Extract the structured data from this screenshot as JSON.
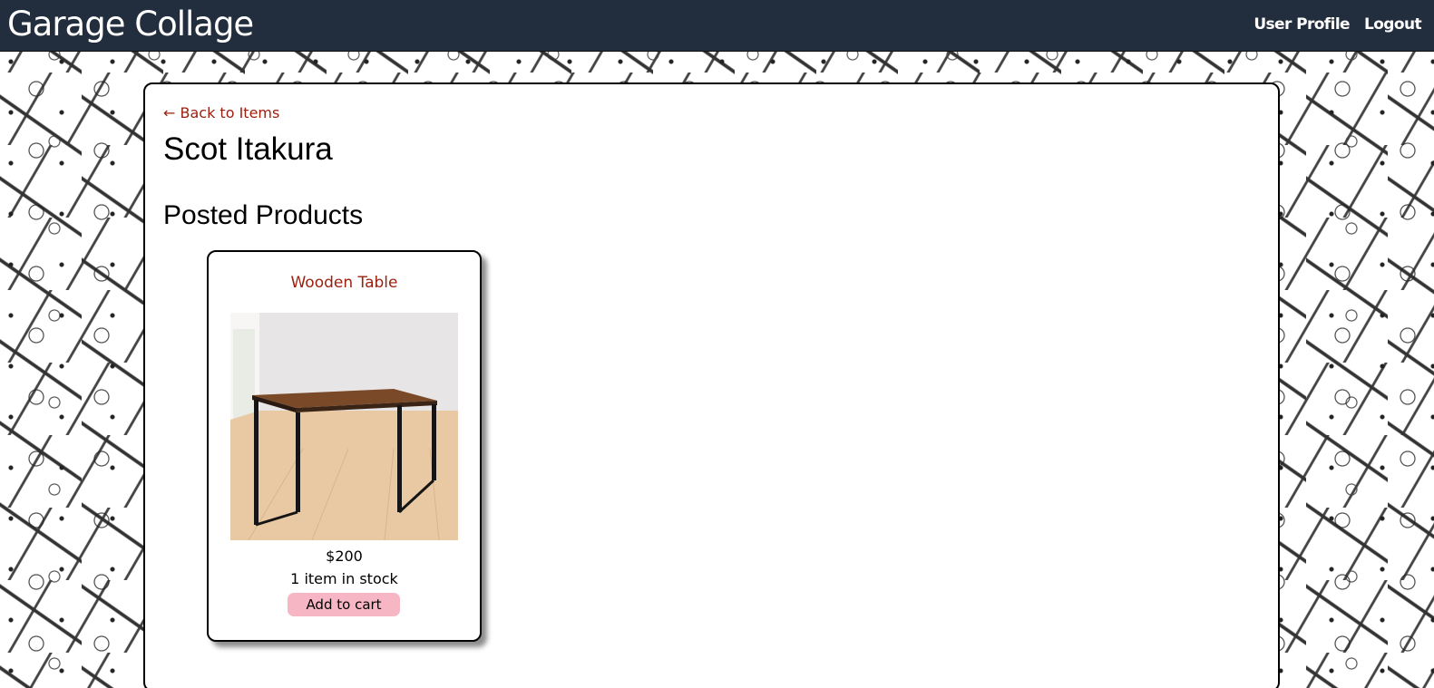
{
  "navbar": {
    "brand": "Garage Collage",
    "links": [
      "User Profile",
      "Logout"
    ]
  },
  "page": {
    "back_link": "← Back to Items",
    "seller_name": "Scot Itakura",
    "section_title": "Posted Products"
  },
  "products": [
    {
      "title": "Wooden Table",
      "price": "$200",
      "stock": "1 item in stock",
      "button_label": "Add to cart"
    }
  ],
  "colors": {
    "navbar": "#222d3d",
    "link_accent": "#9a1f0e",
    "cart_button": "#f7b6c3"
  }
}
